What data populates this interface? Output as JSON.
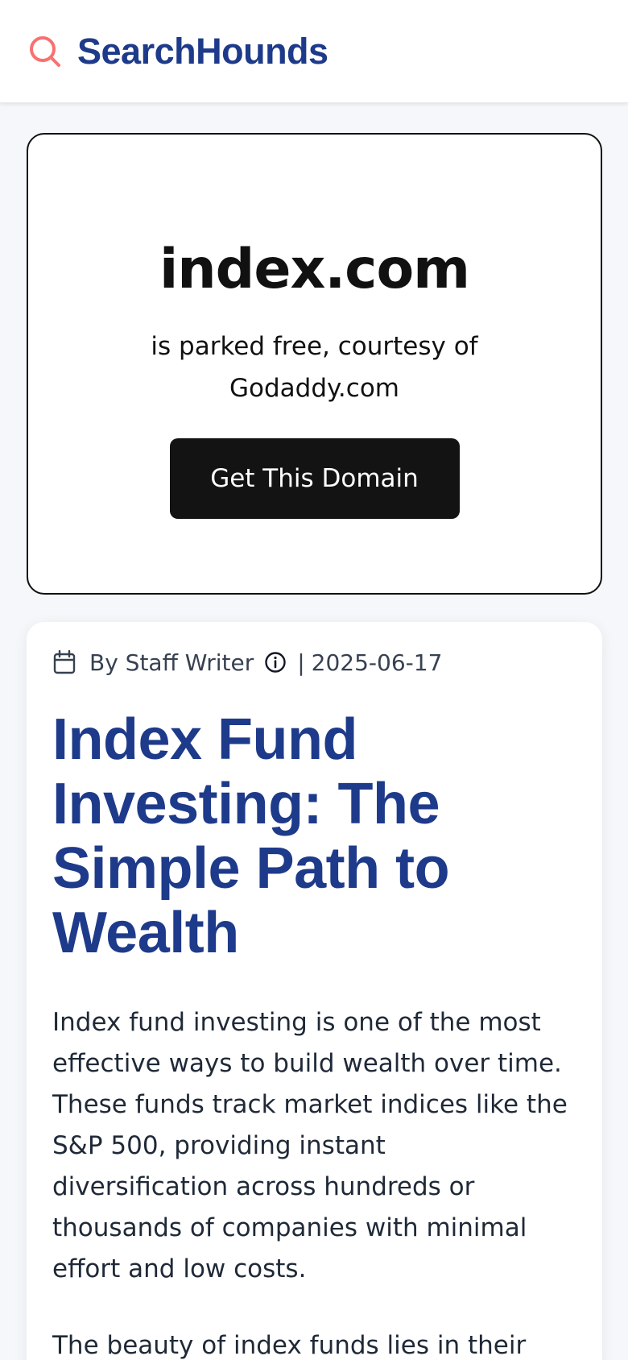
{
  "header": {
    "brand": "SearchHounds",
    "logo_icon": "search-icon",
    "accent_color": "#f87171",
    "brand_color": "#1e3a8a"
  },
  "parked": {
    "domain": "index.com",
    "message": "is parked free, courtesy of Godaddy.com",
    "button_label": "Get This Domain"
  },
  "article": {
    "author": "By Staff Writer",
    "separator": "|",
    "date": "2025-06-17",
    "title": "Index Fund Investing: The Simple Path to Wealth",
    "paragraphs": [
      "Index fund investing is one of the most effective ways to build wealth over time. These funds track market indices like the S&P 500, providing instant diversification across hundreds or thousands of companies with minimal effort and low costs.",
      "The beauty of index funds lies in their"
    ]
  }
}
